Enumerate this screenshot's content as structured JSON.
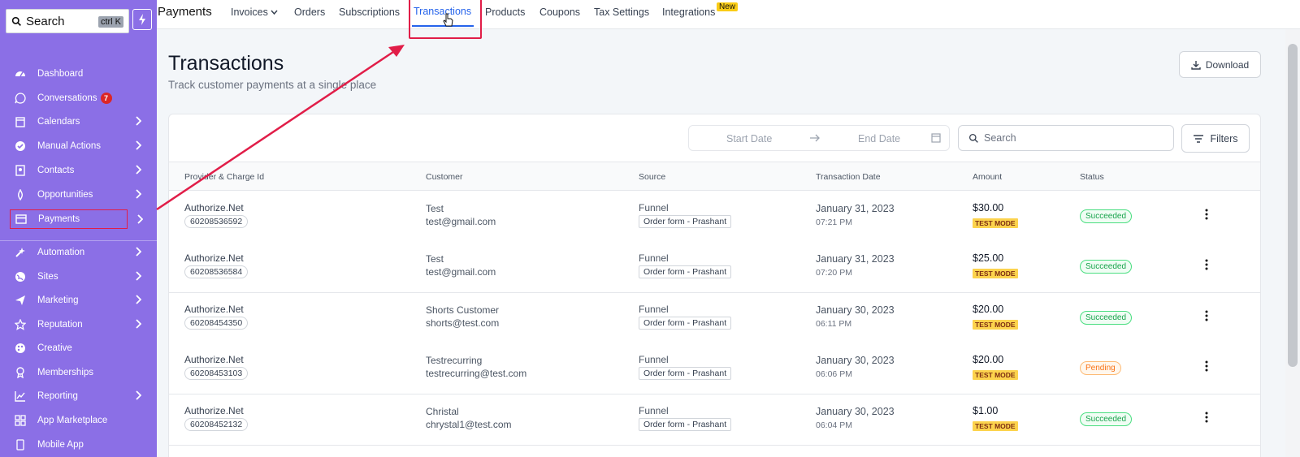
{
  "colors": {
    "sidebar_bg": "#8b6fe6",
    "accent": "#2563eb",
    "annotation": "#e11d48",
    "success": "#16a34a",
    "pending": "#f97316",
    "test_mode": "#fcd34d"
  },
  "sidebar": {
    "search_label": "Search",
    "search_shortcut": "ctrl K",
    "items": [
      {
        "label": "Dashboard",
        "icon": "dashboard-icon"
      },
      {
        "label": "Conversations",
        "icon": "chat-icon",
        "badge": "7"
      },
      {
        "label": "Calendars",
        "icon": "calendar-icon"
      },
      {
        "label": "Manual Actions",
        "icon": "check-circle-icon"
      },
      {
        "label": "Contacts",
        "icon": "contacts-icon"
      },
      {
        "label": "Opportunities",
        "icon": "funnel-icon"
      },
      {
        "label": "Payments",
        "icon": "credit-card-icon"
      },
      {
        "label": "Automation",
        "icon": "automation-icon"
      },
      {
        "label": "Sites",
        "icon": "globe-icon"
      },
      {
        "label": "Marketing",
        "icon": "send-icon"
      },
      {
        "label": "Reputation",
        "icon": "star-icon"
      },
      {
        "label": "Creative",
        "icon": "palette-icon"
      },
      {
        "label": "Memberships",
        "icon": "membership-icon"
      },
      {
        "label": "Reporting",
        "icon": "chart-icon"
      },
      {
        "label": "App Marketplace",
        "icon": "grid-icon"
      },
      {
        "label": "Mobile App",
        "icon": "mobile-icon"
      }
    ]
  },
  "topnav": {
    "title": "Payments",
    "tabs": [
      "Invoices",
      "Orders",
      "Subscriptions",
      "Transactions",
      "Products",
      "Coupons",
      "Tax Settings",
      "Integrations"
    ],
    "active_tab": "Transactions",
    "new_badge": "New"
  },
  "page": {
    "title": "Transactions",
    "subtitle": "Track customer payments at a single place",
    "download_label": "Download"
  },
  "filters": {
    "start_date_placeholder": "Start Date",
    "end_date_placeholder": "End Date",
    "search_placeholder": "Search",
    "filters_label": "Filters"
  },
  "table": {
    "columns": [
      "Provider & Charge Id",
      "Customer",
      "Source",
      "Transaction Date",
      "Amount",
      "Status"
    ],
    "rows": [
      {
        "provider": "Authorize.Net",
        "charge_id": "60208536592",
        "customer_name": "Test",
        "customer_email": "test@gmail.com",
        "source": "Funnel",
        "source_tag": "Order form - Prashant",
        "date": "January 31, 2023",
        "time": "07:21 PM",
        "amount": "$30.00",
        "mode": "TEST MODE",
        "status": "Succeeded"
      },
      {
        "provider": "Authorize.Net",
        "charge_id": "60208536584",
        "customer_name": "Test",
        "customer_email": "test@gmail.com",
        "source": "Funnel",
        "source_tag": "Order form - Prashant",
        "date": "January 31, 2023",
        "time": "07:20 PM",
        "amount": "$25.00",
        "mode": "TEST MODE",
        "status": "Succeeded"
      },
      {
        "provider": "Authorize.Net",
        "charge_id": "60208454350",
        "customer_name": "Shorts Customer",
        "customer_email": "shorts@test.com",
        "source": "Funnel",
        "source_tag": "Order form - Prashant",
        "date": "January 30, 2023",
        "time": "06:11 PM",
        "amount": "$20.00",
        "mode": "TEST MODE",
        "status": "Succeeded"
      },
      {
        "provider": "Authorize.Net",
        "charge_id": "60208453103",
        "customer_name": "Testrecurring",
        "customer_email": "testrecurring@test.com",
        "source": "Funnel",
        "source_tag": "Order form - Prashant",
        "date": "January 30, 2023",
        "time": "06:06 PM",
        "amount": "$20.00",
        "mode": "TEST MODE",
        "status": "Pending"
      },
      {
        "provider": "Authorize.Net",
        "charge_id": "60208452132",
        "customer_name": "Christal",
        "customer_email": "chrystal1@test.com",
        "source": "Funnel",
        "source_tag": "Order form - Prashant",
        "date": "January 30, 2023",
        "time": "06:04 PM",
        "amount": "$1.00",
        "mode": "TEST MODE",
        "status": "Succeeded"
      }
    ]
  }
}
